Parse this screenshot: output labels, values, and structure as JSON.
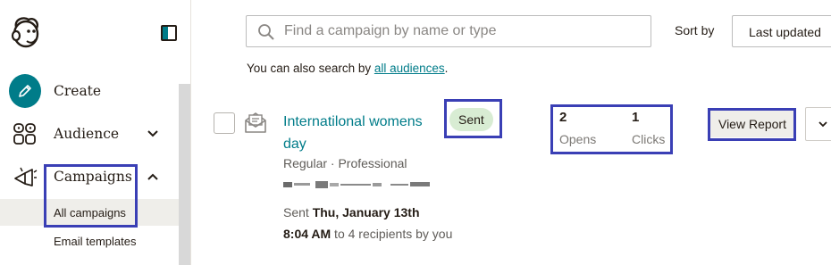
{
  "sidebar": {
    "nav": {
      "create": "Create",
      "audience": "Audience",
      "campaigns": "Campaigns"
    },
    "campaigns_sub": {
      "all_campaigns": "All campaigns",
      "email_templates": "Email templates"
    }
  },
  "toolbar": {
    "search_placeholder": "Find a campaign by name or type",
    "search_value": "",
    "sort_label": "Sort by",
    "sort_value": "Last updated"
  },
  "hint": {
    "prefix": "You can also search by ",
    "link": "all audiences",
    "suffix": "."
  },
  "campaign": {
    "title": "Internatilonal womens day",
    "type": "Regular · Professional",
    "status": "Sent",
    "sent_prefix": "Sent ",
    "sent_date": "Thu, January 13th",
    "sent_time": "8:04 AM",
    "sent_suffix": " to 4 recipients by you",
    "stats": [
      {
        "value": "2",
        "label": "Opens"
      },
      {
        "value": "1",
        "label": "Clicks"
      }
    ],
    "view_report": "View Report"
  },
  "colors": {
    "accent": "#007c89",
    "highlight": "#3a3fb5",
    "sent_badge": "#d8ecd3"
  }
}
